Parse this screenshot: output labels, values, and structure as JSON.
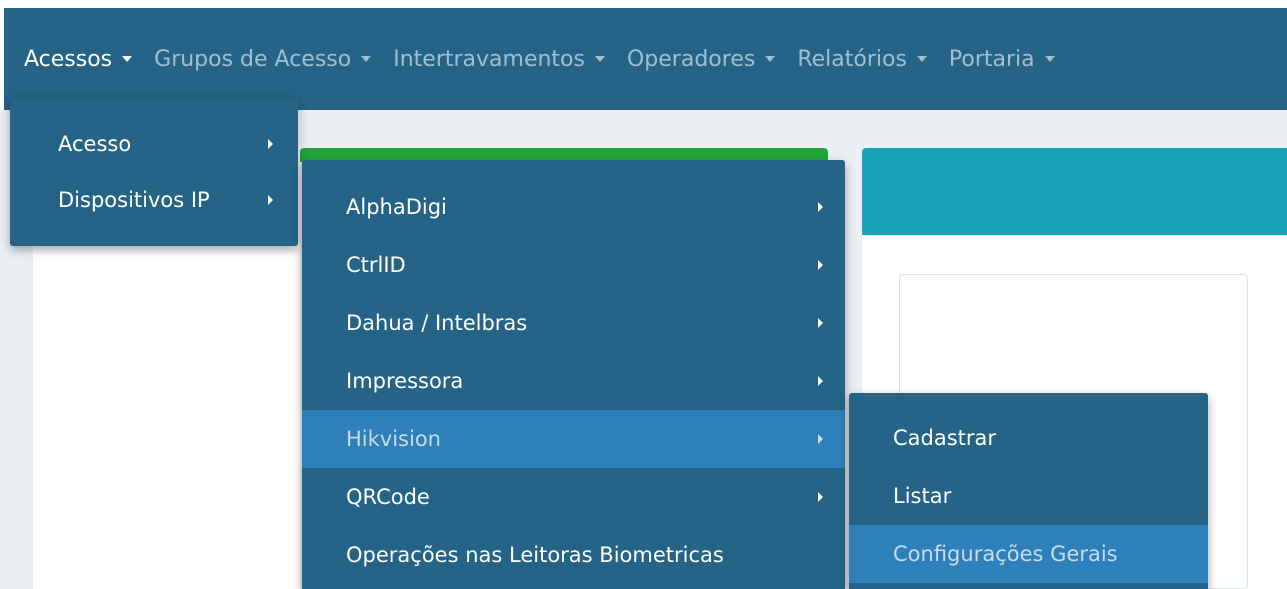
{
  "navbar": {
    "items": [
      {
        "label": "Acessos"
      },
      {
        "label": "Grupos de Acesso"
      },
      {
        "label": "Intertravamentos"
      },
      {
        "label": "Operadores"
      },
      {
        "label": "Relatórios"
      },
      {
        "label": "Portaria"
      }
    ]
  },
  "menu_level1": {
    "items": [
      {
        "label": "Acesso"
      },
      {
        "label": "Dispositivos IP"
      }
    ]
  },
  "menu_level2": {
    "items": [
      {
        "label": "AlphaDigi"
      },
      {
        "label": "CtrlID"
      },
      {
        "label": "Dahua / Intelbras"
      },
      {
        "label": "Impressora"
      },
      {
        "label": "Hikvision"
      },
      {
        "label": "QRCode"
      },
      {
        "label": "Operações nas Leitoras Biometricas"
      }
    ]
  },
  "menu_level3": {
    "items": [
      {
        "label": "Cadastrar"
      },
      {
        "label": "Listar"
      },
      {
        "label": "Configurações Gerais"
      }
    ]
  },
  "colors": {
    "navbar_bg": "#256486",
    "menu_highlight": "#2d80b9",
    "success_box": "#22a33a",
    "info_box": "#19a2ba"
  }
}
